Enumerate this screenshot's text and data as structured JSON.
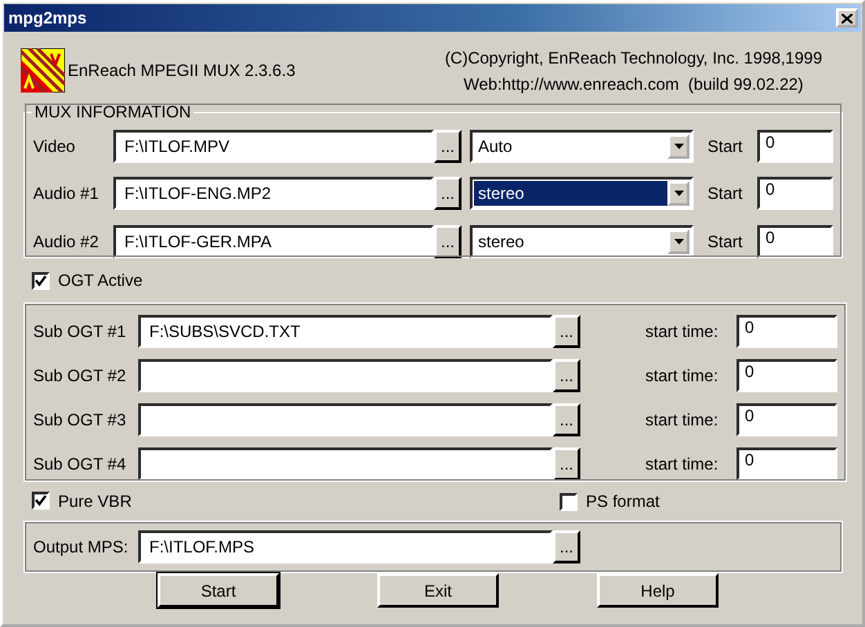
{
  "window": {
    "title": "mpg2mps"
  },
  "header": {
    "product": "EnReach MPEGII MUX 2.3.6.3",
    "copyright": "(C)Copyright, EnReach Technology, Inc. 1998,1999",
    "web": "Web:http://www.enreach.com  (build 99.02.22)"
  },
  "mux": {
    "title": "MUX INFORMATION",
    "rows": [
      {
        "label": "Video",
        "file": "F:\\ITLOF.MPV",
        "browse": "...",
        "mode": "Auto",
        "focused": false,
        "start_label": "Start",
        "start": "0"
      },
      {
        "label": "Audio #1",
        "file": "F:\\ITLOF-ENG.MP2",
        "browse": "...",
        "mode": "stereo",
        "focused": true,
        "start_label": "Start",
        "start": "0"
      },
      {
        "label": "Audio #2",
        "file": "F:\\ITLOF-GER.MPA",
        "browse": "...",
        "mode": "stereo",
        "focused": false,
        "start_label": "Start",
        "start": "0"
      }
    ]
  },
  "ogt_active": {
    "label": "OGT Active",
    "checked": true
  },
  "subs": [
    {
      "label": "Sub OGT #1",
      "file": "F:\\SUBS\\SVCD.TXT",
      "browse": "...",
      "start_label": "start time:",
      "start": "0"
    },
    {
      "label": "Sub OGT #2",
      "browse": "...",
      "start_label": "start time:",
      "start": "0"
    },
    {
      "label": "Sub OGT #3",
      "browse": "...",
      "start_label": "start time:",
      "start": "0"
    },
    {
      "label": "Sub OGT #4",
      "browse": "...",
      "start_label": "start time:",
      "start": "0"
    }
  ],
  "pure_vbr": {
    "label": "Pure VBR",
    "checked": true
  },
  "ps_format": {
    "label": "PS format",
    "checked": false
  },
  "output": {
    "label": "Output MPS:",
    "file": "F:\\ITLOF.MPS",
    "browse": "..."
  },
  "buttons": [
    {
      "label": "Start",
      "default": true
    },
    {
      "label": "Exit",
      "default": false
    },
    {
      "label": "Help",
      "default": false
    }
  ]
}
